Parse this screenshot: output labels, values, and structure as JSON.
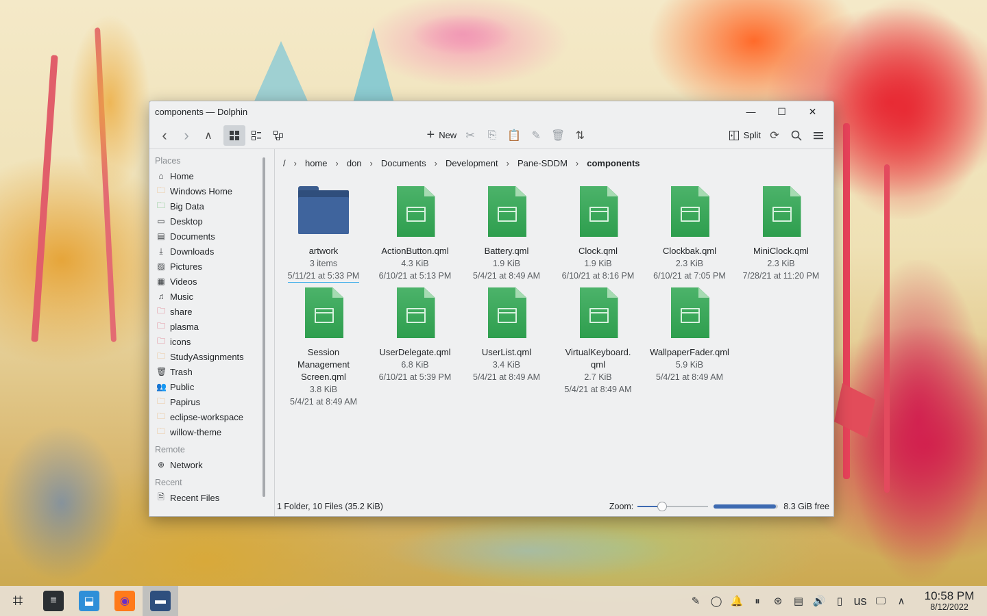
{
  "window": {
    "title": "components — Dolphin",
    "minimize": "—",
    "maximize": "☐",
    "close": "✕"
  },
  "toolbar": {
    "back": "‹",
    "forward": "›",
    "up": "∧",
    "new_label": "New",
    "split_label": "Split"
  },
  "sidebar": {
    "places_header": "Places",
    "places": [
      {
        "label": "Home",
        "icon": "⌂"
      },
      {
        "label": "Windows Home",
        "icon": "🗀"
      },
      {
        "label": "Big Data",
        "icon": "🗀"
      },
      {
        "label": "Desktop",
        "icon": "▭"
      },
      {
        "label": "Documents",
        "icon": "▤"
      },
      {
        "label": "Downloads",
        "icon": "⤓"
      },
      {
        "label": "Pictures",
        "icon": "▨"
      },
      {
        "label": "Videos",
        "icon": "▦"
      },
      {
        "label": "Music",
        "icon": "♫"
      },
      {
        "label": "share",
        "icon": "🗀"
      },
      {
        "label": "plasma",
        "icon": "🗀"
      },
      {
        "label": "icons",
        "icon": "🗀"
      },
      {
        "label": "StudyAssignments",
        "icon": "🗀"
      },
      {
        "label": "Trash",
        "icon": "🗑"
      },
      {
        "label": "Public",
        "icon": "👥"
      },
      {
        "label": "Papirus",
        "icon": "🗀"
      },
      {
        "label": "eclipse-workspace",
        "icon": "🗀"
      },
      {
        "label": "willow-theme",
        "icon": "🗀"
      }
    ],
    "remote_header": "Remote",
    "remote": [
      {
        "label": "Network",
        "icon": "⊕"
      }
    ],
    "recent_header": "Recent",
    "recent": [
      {
        "label": "Recent Files",
        "icon": "🗎"
      }
    ]
  },
  "breadcrumb": {
    "root": "/",
    "parts": [
      "home",
      "don",
      "Documents",
      "Development",
      "Pane-SDDM"
    ],
    "current": "components",
    "separator": "›"
  },
  "files": [
    {
      "name": "artwork",
      "size": "3 items",
      "date": "5/11/21 at 5:33 PM",
      "type": "folder"
    },
    {
      "name": "ActionButton.qml",
      "size": "4.3 KiB",
      "date": "6/10/21 at 5:13 PM",
      "type": "file"
    },
    {
      "name": "Battery.qml",
      "size": "1.9 KiB",
      "date": "5/4/21 at 8:49 AM",
      "type": "file"
    },
    {
      "name": "Clock.qml",
      "size": "1.9 KiB",
      "date": "6/10/21 at 8:16 PM",
      "type": "file"
    },
    {
      "name": "Clockbak.qml",
      "size": "2.3 KiB",
      "date": "6/10/21 at 7:05 PM",
      "type": "file"
    },
    {
      "name": "MiniClock.qml",
      "size": "2.3 KiB",
      "date": "7/28/21 at 11:20 PM",
      "type": "file"
    },
    {
      "name": "Session Management Screen.qml",
      "name_lines": [
        "Session",
        "Management",
        "Screen.qml"
      ],
      "size": "3.8 KiB",
      "date": "5/4/21 at 8:49 AM",
      "type": "file"
    },
    {
      "name": "UserDelegate.qml",
      "size": "6.8 KiB",
      "date": "6/10/21 at 5:39 PM",
      "type": "file"
    },
    {
      "name": "UserList.qml",
      "size": "3.4 KiB",
      "date": "5/4/21 at 8:49 AM",
      "type": "file"
    },
    {
      "name": "VirtualKeyboard.qml",
      "name_lines": [
        "VirtualKeyboard.",
        "qml"
      ],
      "size": "2.7 KiB",
      "date": "5/4/21 at 8:49 AM",
      "type": "file"
    },
    {
      "name": "WallpaperFader.qml",
      "size": "5.9 KiB",
      "date": "5/4/21 at 8:49 AM",
      "type": "file"
    }
  ],
  "status": {
    "summary": "1 Folder, 10 Files (35.2 KiB)",
    "zoom_label": "Zoom:",
    "zoom_fraction": 0.35,
    "free_space": "8.3 GiB free",
    "used_fraction": 0.97
  },
  "taskbar": {
    "apps": [
      {
        "name": "app-launcher",
        "glyph": "⌗",
        "bg": "transparent",
        "fg": "#232629"
      },
      {
        "name": "system-settings",
        "glyph": "≡",
        "bg": "#2b2f33",
        "fg": "#ffffff"
      },
      {
        "name": "discover",
        "glyph": "⬓",
        "bg": "#2f8fd8",
        "fg": "#ffffff"
      },
      {
        "name": "firefox",
        "glyph": "◉",
        "bg": "#ff7a1a",
        "fg": "#6a2ec4"
      },
      {
        "name": "dolphin",
        "glyph": "▬",
        "bg": "#2e4f7e",
        "fg": "#ffffff"
      }
    ],
    "tray": [
      "✎",
      "◯",
      "🔔",
      "⏸",
      "⊛",
      "▤",
      "🔊",
      "▯",
      "us",
      "🖵",
      "∧"
    ],
    "time": "10:58 PM",
    "date": "8/12/2022"
  },
  "colors": {
    "accent": "#3daee9",
    "folder": "#3f649d",
    "file_green": "#2e9e4e"
  }
}
